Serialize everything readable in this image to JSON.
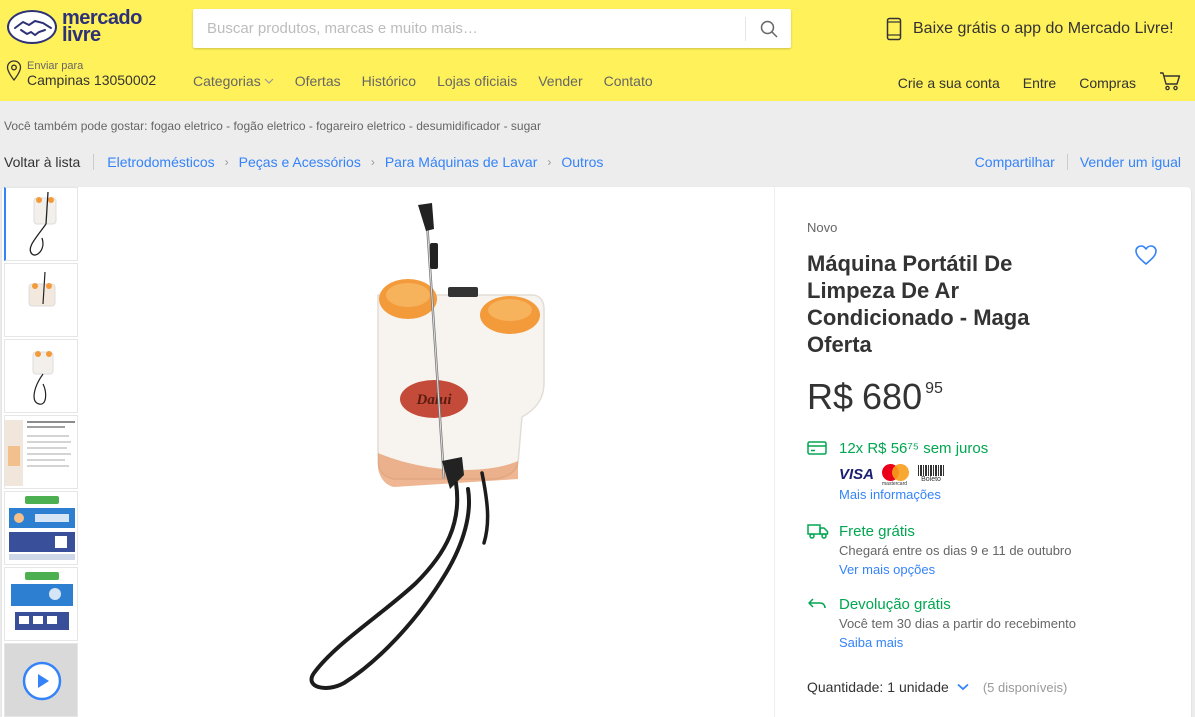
{
  "header": {
    "logo_text_line1": "mercado",
    "logo_text_line2": "livre",
    "search_placeholder": "Buscar produtos, marcas e muito mais…",
    "app_promo": "Baixe grátis o app do Mercado Livre!",
    "location_label": "Enviar para",
    "location_value": "Campinas 13050002",
    "nav": [
      "Categorias",
      "Ofertas",
      "Histórico",
      "Lojas oficiais",
      "Vender",
      "Contato"
    ],
    "account": [
      "Crie a sua conta",
      "Entre",
      "Compras"
    ]
  },
  "related_searches": "Você também pode gostar: fogao eletrico - fogão eletrico - fogareiro eletrico - desumidificador - sugar",
  "breadcrumb": {
    "back": "Voltar à lista",
    "items": [
      "Eletrodomésticos",
      "Peças e Acessórios",
      "Para Máquinas de Lavar",
      "Outros"
    ],
    "share": "Compartilhar",
    "sell_similar": "Vender um igual"
  },
  "product": {
    "condition": "Novo",
    "title": "Máquina Portátil De Limpeza De Ar Condicionado - Maga Oferta",
    "price_currency": "R$",
    "price_integer": "680",
    "price_cents": "95",
    "installments": "12x R$ 56⁷⁵ sem juros",
    "payment_logos": [
      "VISA",
      "mastercard",
      "Boleto"
    ],
    "more_info": "Mais informações",
    "shipping_title": "Frete grátis",
    "shipping_detail": "Chegará entre os dias 9 e 11 de outubro",
    "shipping_link": "Ver mais opções",
    "return_title": "Devolução grátis",
    "return_detail": "Você tem 30 dias a partir do recebimento",
    "return_link": "Saiba mais",
    "quantity_label": "Quantidade:",
    "quantity_value": "1 unidade",
    "available": "(5 disponíveis)",
    "image_label": "Dalui"
  },
  "colors": {
    "header_bg": "#fff159",
    "link_blue": "#3483fa",
    "green": "#00a650",
    "brand_navy": "#2d3277"
  },
  "icons": [
    "handshake-logo-icon",
    "search-icon",
    "phone-icon",
    "location-pin-icon",
    "chevron-down-icon",
    "cart-icon",
    "heart-icon",
    "card-icon",
    "truck-icon",
    "return-icon",
    "play-icon"
  ]
}
